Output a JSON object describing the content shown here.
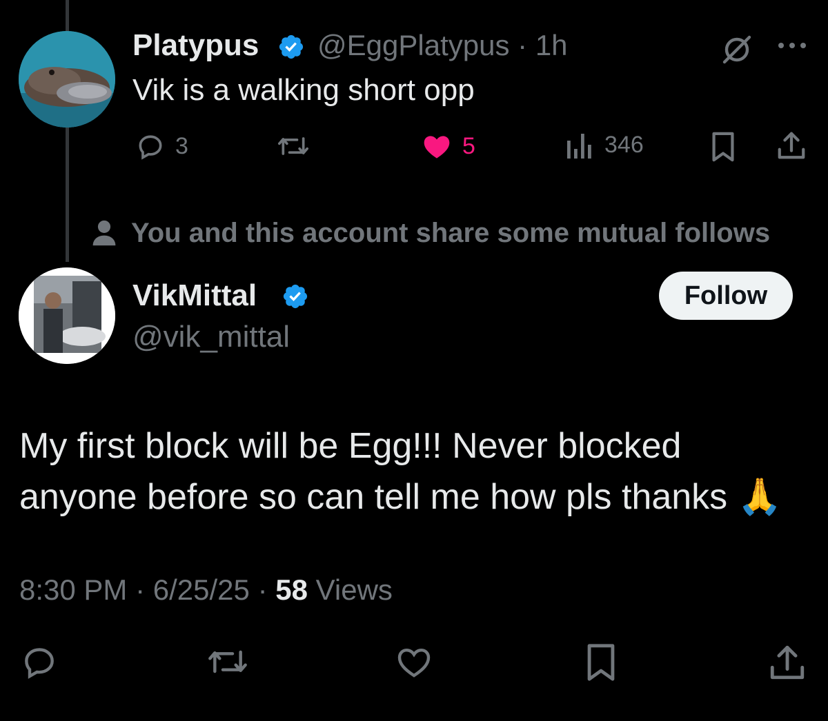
{
  "parent_tweet": {
    "display_name": "Platypus",
    "handle": "@EggPlatypus",
    "separator": "·",
    "time_ago": "1h",
    "text": "Vik is a walking short opp",
    "reply_count": "3",
    "like_count": "5",
    "view_count": "346",
    "icons": [
      "verified-badge-icon",
      "grok-icon",
      "more-icon",
      "reply-icon",
      "retweet-icon",
      "heart-filled-icon",
      "views-chart-icon",
      "bookmark-icon",
      "share-icon"
    ]
  },
  "mutual_notice": {
    "text": "You and this account share some mutual follows",
    "icon": "person-icon"
  },
  "main_tweet": {
    "display_name": "VikMittal",
    "handle": "@vik_mittal",
    "follow_label": "Follow",
    "text_line1": "My first block will be Egg!!! Never blocked",
    "text_line2": "anyone before so can tell me how pls thanks",
    "emoji": "🙏",
    "time": "8:30 PM",
    "date": "6/25/25",
    "views_count": "58",
    "views_label": "Views",
    "separator": "·",
    "icons": [
      "reply-icon",
      "retweet-icon",
      "heart-icon",
      "bookmark-icon",
      "share-icon"
    ]
  },
  "colors": {
    "background": "#000000",
    "text_primary": "#e7e9ea",
    "text_secondary": "#71767b",
    "verified_blue": "#1d9bf0",
    "like_pink": "#f91880",
    "follow_button_bg": "#eff3f4"
  }
}
